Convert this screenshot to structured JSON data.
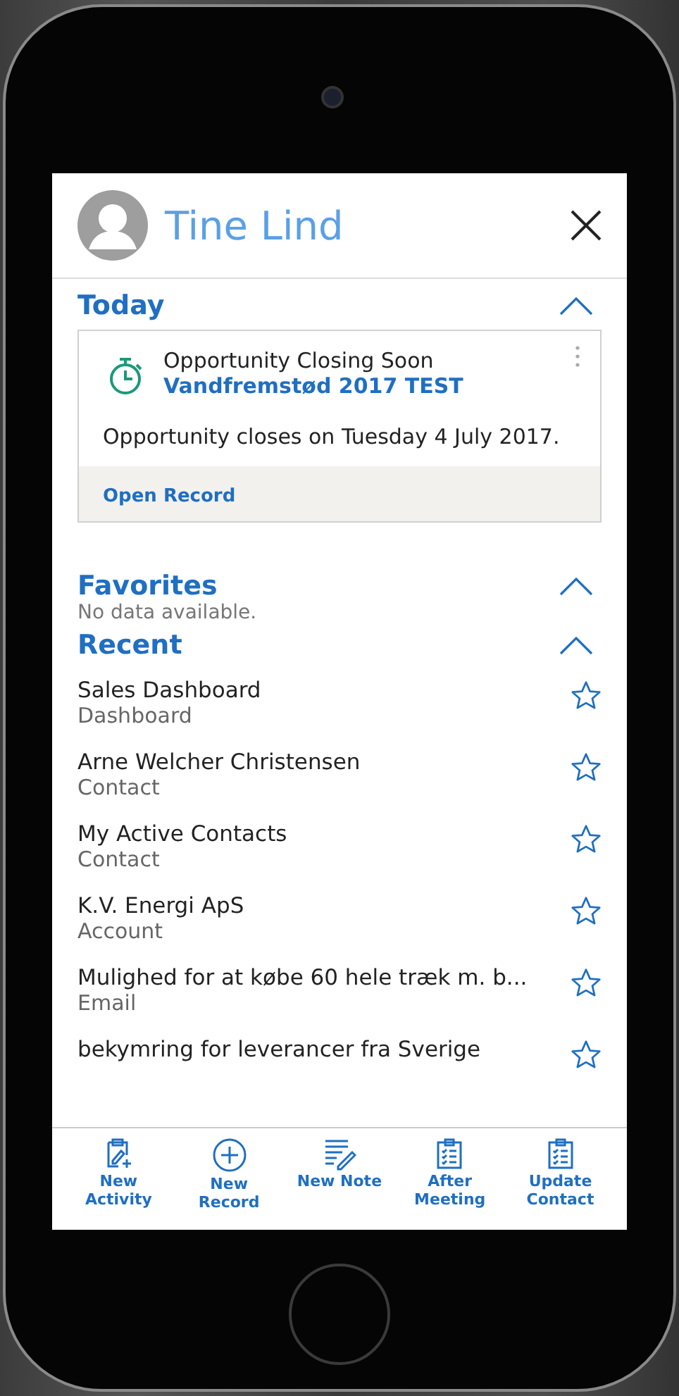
{
  "header": {
    "user_name": "Tine Lind"
  },
  "today": {
    "title": "Today",
    "expanded": true,
    "card": {
      "title": "Opportunity Closing Soon",
      "record": "Vandfremstød 2017 TEST",
      "message": "Opportunity closes on Tuesday 4 July 2017.",
      "action": "Open Record"
    }
  },
  "favorites": {
    "title": "Favorites",
    "expanded": true,
    "empty_text": "No data available."
  },
  "recent": {
    "title": "Recent",
    "expanded": true,
    "items": [
      {
        "title": "Sales Dashboard",
        "type": "Dashboard",
        "favorite": false
      },
      {
        "title": "Arne Welcher Christensen",
        "type": "Contact",
        "favorite": false
      },
      {
        "title": "My Active Contacts",
        "type": "Contact",
        "favorite": false
      },
      {
        "title": "K.V. Energi ApS",
        "type": "Account",
        "favorite": false
      },
      {
        "title": "Mulighed for at købe 60 hele træk m. b...",
        "type": "Email",
        "favorite": false
      },
      {
        "title": "bekymring for leverancer fra Sverige",
        "favorite": false
      }
    ]
  },
  "toolbar": [
    {
      "kind": "activity",
      "label": "New Activity"
    },
    {
      "kind": "record",
      "label": "New Record"
    },
    {
      "kind": "note",
      "label": "New Note"
    },
    {
      "kind": "meeting",
      "label": "After Meeting"
    },
    {
      "kind": "contact",
      "label": "Update Contact"
    }
  ]
}
